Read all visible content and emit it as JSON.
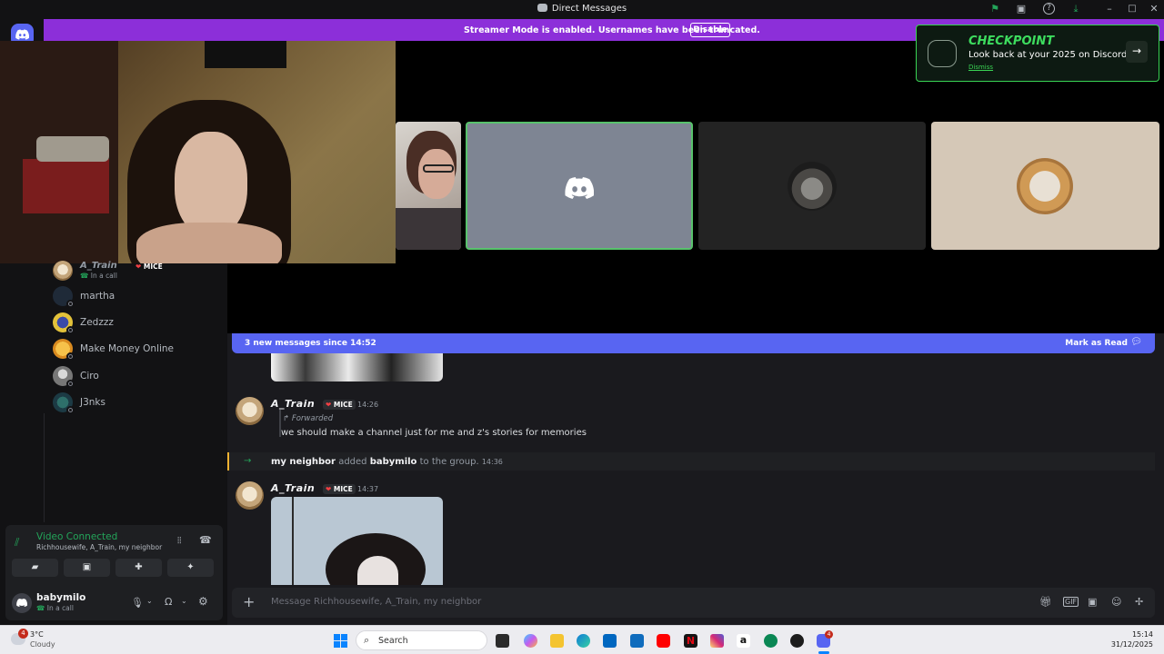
{
  "window": {
    "title": "Direct Messages"
  },
  "banner": {
    "text": "Streamer Mode is enabled. Usernames have been truncated.",
    "button": "Disable"
  },
  "promo": {
    "title": "CHECKPOINT",
    "subtitle": "Look back at your 2025 on Discord",
    "dismiss": "Dismiss"
  },
  "dm_list": [
    {
      "name": "A_Train",
      "badge": "MICE",
      "status": "In a call"
    },
    {
      "name": "martha"
    },
    {
      "name": "Zedzzz"
    },
    {
      "name": "Make Money Online"
    },
    {
      "name": "Ciro"
    },
    {
      "name": "J3nks"
    }
  ],
  "voice": {
    "status": "Video Connected",
    "participants": "Richhousewife, A_Train, my neighbor"
  },
  "user": {
    "name": "babymilo",
    "status": "In a call"
  },
  "new_messages": {
    "text": "3 new messages since 14:52",
    "action": "Mark as Read"
  },
  "messages": [
    {
      "author": "A_Train",
      "badge": "MICE",
      "time": "14:26",
      "forwarded_label": "Forwarded",
      "text": "we should make a channel just for me and z's stories for memories"
    },
    {
      "system_actor": "my neighbor",
      "system_verb": "added",
      "system_target": "babymilo",
      "system_rest": "to the group.",
      "time": "14:36"
    },
    {
      "author": "A_Train",
      "badge": "MICE",
      "time": "14:37"
    }
  ],
  "input": {
    "placeholder": "Message Richhousewife, A_Train, my neighbor"
  },
  "taskbar": {
    "weather_temp": "3°C",
    "weather_desc": "Cloudy",
    "weather_badge": "4",
    "search": "Search",
    "time": "15:14",
    "date": "31/12/2025",
    "discord_badge": "4"
  }
}
